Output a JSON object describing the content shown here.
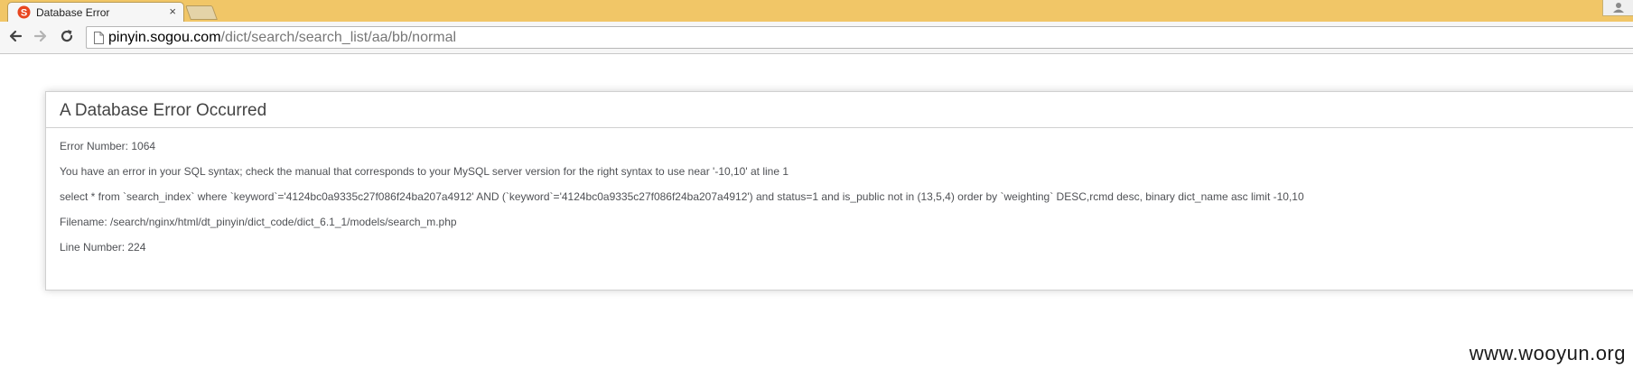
{
  "browser": {
    "tab": {
      "title": "Database Error",
      "close_glyph": "×",
      "favicon": "sogou-s-icon"
    },
    "colors": {
      "tabstrip": "#f1c667",
      "toolbar": "#f6f6f6"
    },
    "toolbar": {
      "back_icon": "back-arrow-icon",
      "forward_icon": "forward-arrow-icon",
      "reload_icon": "reload-icon",
      "url_host": "pinyin.sogou.com",
      "url_path": "/dict/search/search_list/aa/bb/normal"
    }
  },
  "error": {
    "title": "A Database Error Occurred",
    "error_number": "Error Number: 1064",
    "message": "You have an error in your SQL syntax; check the manual that corresponds to your MySQL server version for the right syntax to use near '-10,10' at line 1",
    "query": "select * from `search_index` where `keyword`='4124bc0a9335c27f086f24ba207a4912' AND (`keyword`='4124bc0a9335c27f086f24ba207a4912') and status=1 and is_public not in (13,5,4) order by `weighting` DESC,rcmd desc, binary dict_name asc limit -10,10",
    "filename": "Filename: /search/nginx/html/dt_pinyin/dict_code/dict_6.1_1/models/search_m.php",
    "line_number": "Line Number: 224"
  },
  "watermark": "www.wooyun.org"
}
